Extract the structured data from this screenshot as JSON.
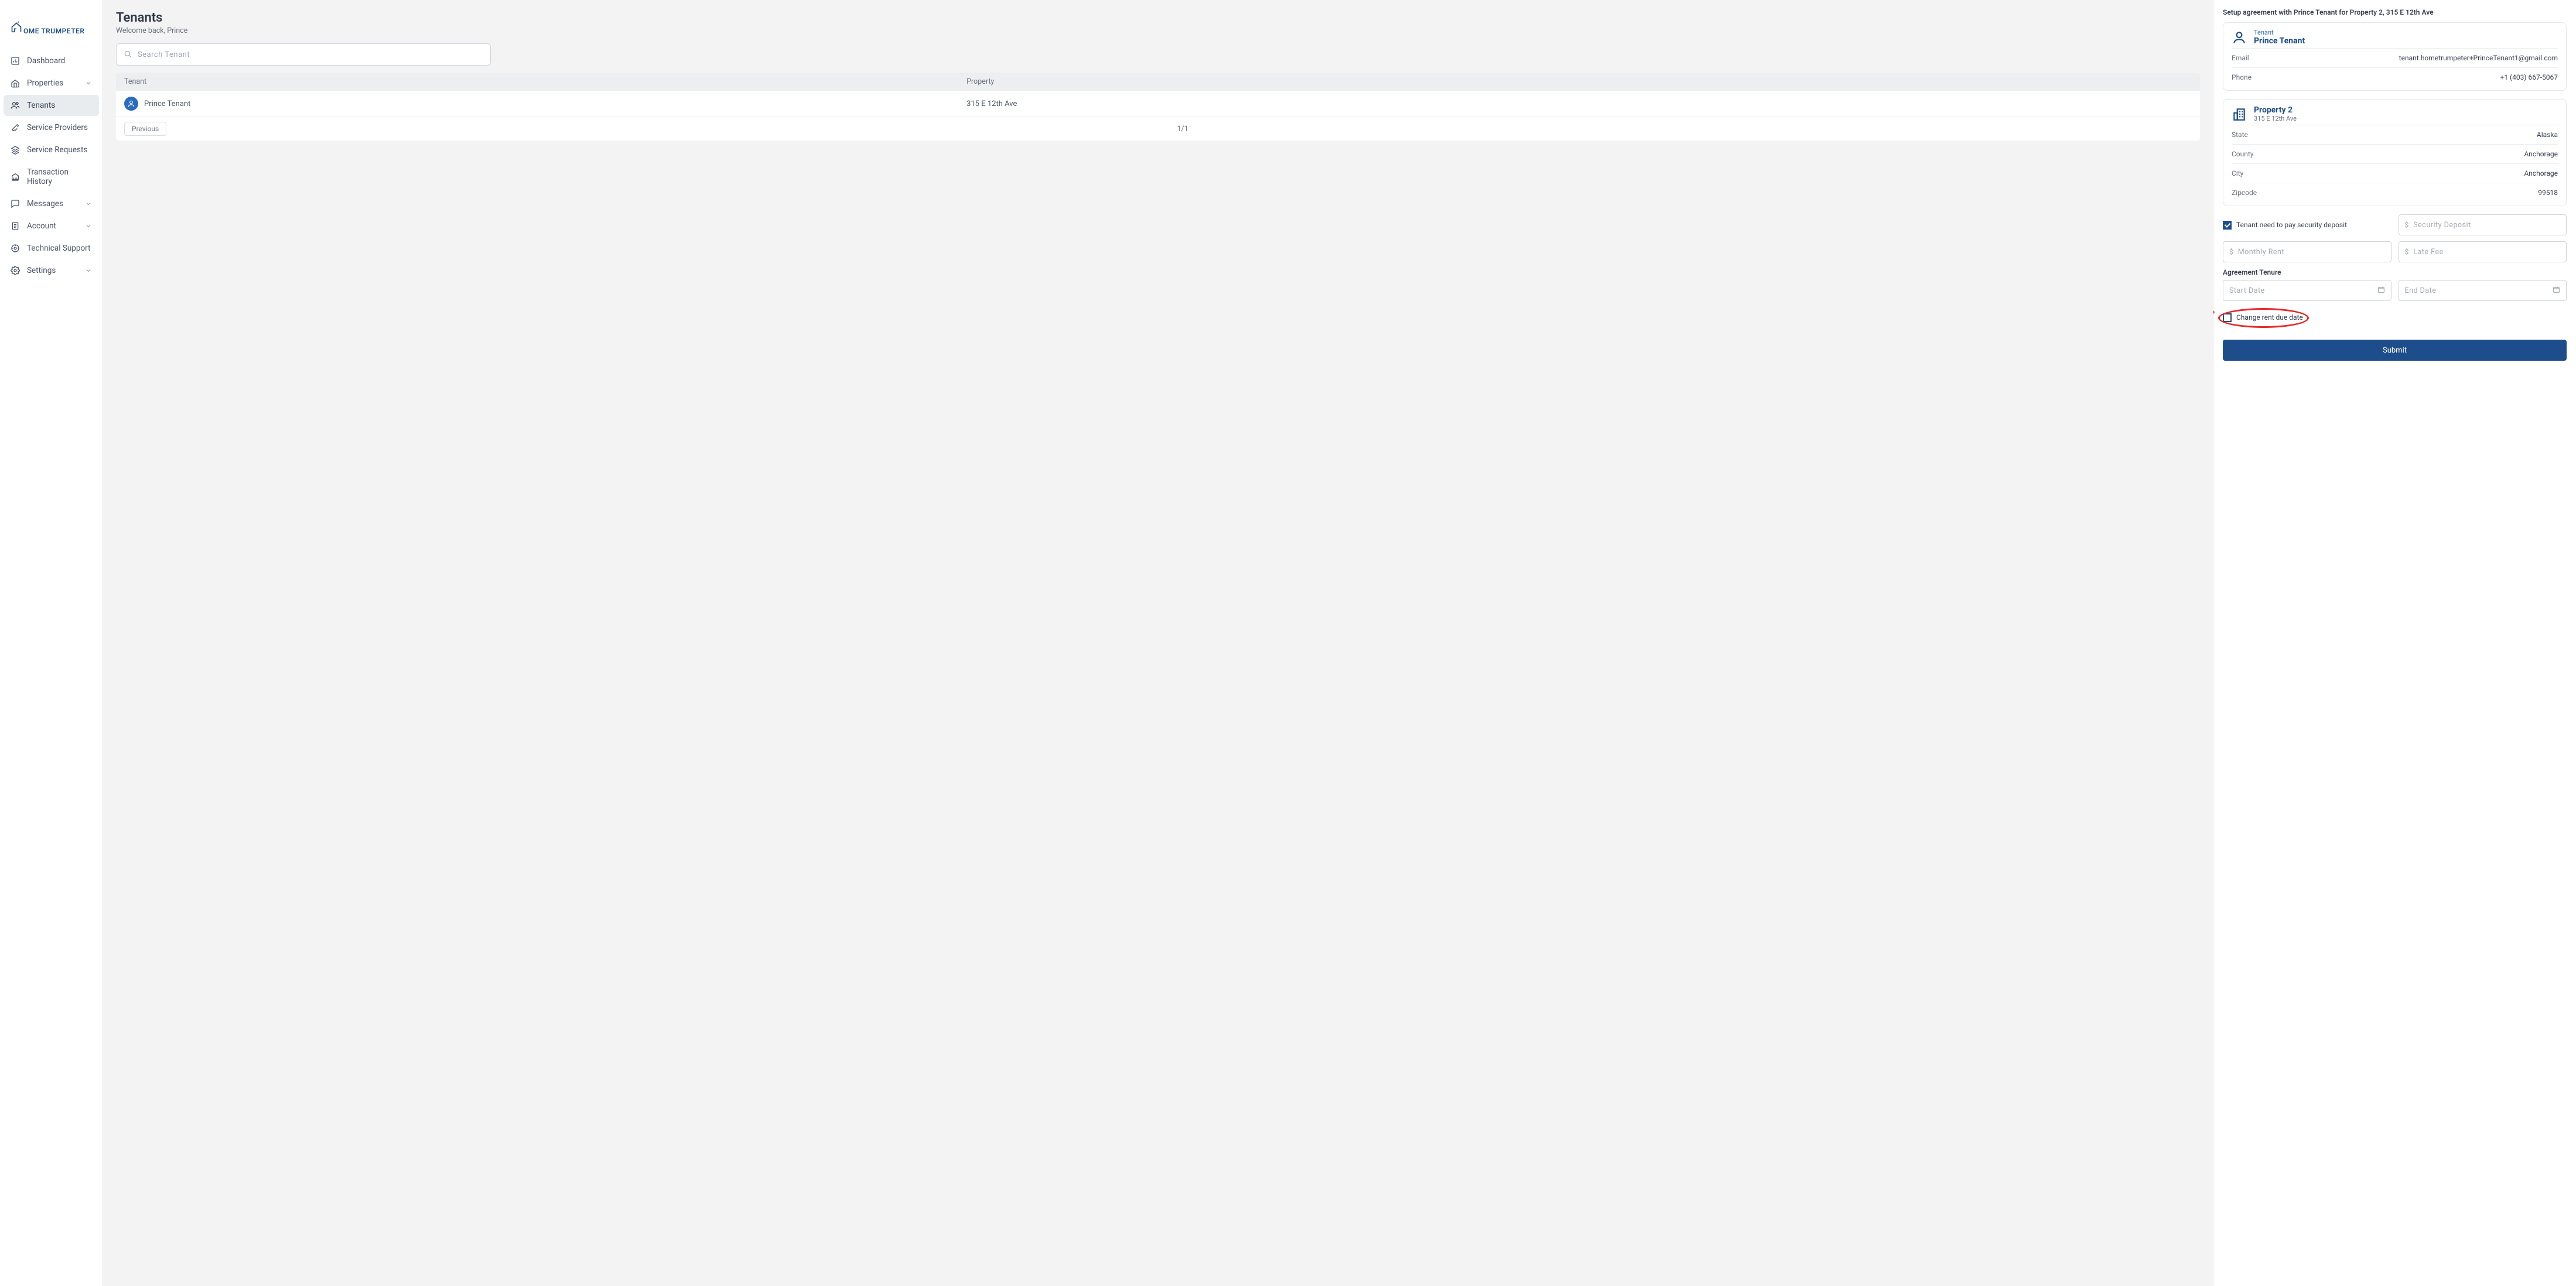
{
  "brand": {
    "name": "OME TRUMPETER"
  },
  "sidebar": {
    "items": [
      {
        "label": "Dashboard",
        "icon": "bar-chart",
        "expandable": false
      },
      {
        "label": "Properties",
        "icon": "home",
        "expandable": true
      },
      {
        "label": "Tenants",
        "icon": "users",
        "expandable": false,
        "active": true
      },
      {
        "label": "Service Providers",
        "icon": "wrench",
        "expandable": false
      },
      {
        "label": "Service Requests",
        "icon": "layers",
        "expandable": false
      },
      {
        "label": "Transaction History",
        "icon": "bank",
        "expandable": false
      },
      {
        "label": "Messages",
        "icon": "chat",
        "expandable": true
      },
      {
        "label": "Account",
        "icon": "doc-user",
        "expandable": true
      },
      {
        "label": "Technical Support",
        "icon": "support",
        "expandable": false
      },
      {
        "label": "Settings",
        "icon": "gear",
        "expandable": true
      }
    ]
  },
  "main": {
    "title": "Tenants",
    "subtitle": "Welcome back, Prince",
    "search_placeholder": "Search Tenant",
    "columns": {
      "c1": "Tenant",
      "c2": "Property",
      "c3": ""
    },
    "rows": [
      {
        "tenant": "Prince Tenant",
        "property": "315 E 12th Ave"
      }
    ],
    "pagination": {
      "prev": "Previous",
      "page": "1/1"
    }
  },
  "panel": {
    "setup_title": "Setup agreement with Prince Tenant for Property 2, 315 E 12th Ave",
    "tenant_card": {
      "label": "Tenant",
      "name": "Prince Tenant",
      "email_k": "Email",
      "email_v": "tenant.hometrumpeter+PrinceTenant1@gmail.com",
      "phone_k": "Phone",
      "phone_v": "+1 (403) 667-5067"
    },
    "property_card": {
      "title": "Property 2",
      "address": "315 E 12th Ave",
      "state_k": "State",
      "state_v": "Alaska",
      "county_k": "County",
      "county_v": "Anchorage",
      "city_k": "City",
      "city_v": "Anchorage",
      "zip_k": "Zipcode",
      "zip_v": "99518"
    },
    "form": {
      "sec_deposit_check_label": "Tenant need to pay security deposit",
      "sec_deposit_placeholder": "Security Deposit",
      "monthly_rent_placeholder": "Monthly Rent",
      "late_fee_placeholder": "Late Fee",
      "tenure_heading": "Agreement Tenure",
      "start_date_placeholder": "Start Date",
      "end_date_placeholder": "End Date",
      "change_due_label": "Change rent due date",
      "submit_label": "Submit"
    }
  }
}
